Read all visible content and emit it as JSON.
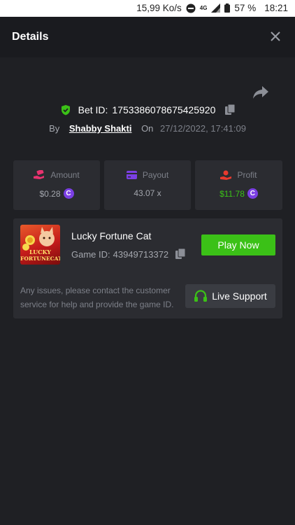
{
  "status_bar": {
    "speed": "15,99 Ko/s",
    "network": "4G",
    "battery": "57 %",
    "time": "18:21"
  },
  "header": {
    "title": "Details",
    "close_icon": "close-icon"
  },
  "bet": {
    "label": "Bet ID:",
    "id": "1753386078675425920",
    "by_label": "By",
    "user": "Shabby Shakti",
    "on_label": "On",
    "datetime": "27/12/2022, 17:41:09"
  },
  "stats": {
    "amount": {
      "label": "Amount",
      "value": "$0.28",
      "icon": "hand-money-icon",
      "color": "#e8336f"
    },
    "payout": {
      "label": "Payout",
      "value": "43.07 x",
      "icon": "card-icon",
      "color": "#7b3fe4"
    },
    "profit": {
      "label": "Profit",
      "value": "$11.78",
      "icon": "hand-coin-icon",
      "color": "#e83a2e",
      "value_color": "#3bc117"
    }
  },
  "game": {
    "thumb_text_1": "LUCKY",
    "thumb_text_2": "FORTUNECAT",
    "name": "Lucky Fortune Cat",
    "id_label": "Game ID:",
    "id": "43949713372",
    "play_label": "Play Now"
  },
  "support": {
    "text": "Any issues, please contact the customer service for help and provide the game ID.",
    "button_label": "Live Support"
  },
  "colors": {
    "background": "#1f2024",
    "card": "#2b2c31",
    "accent_green": "#3bc117",
    "coin_purple": "#7b3fe4"
  }
}
